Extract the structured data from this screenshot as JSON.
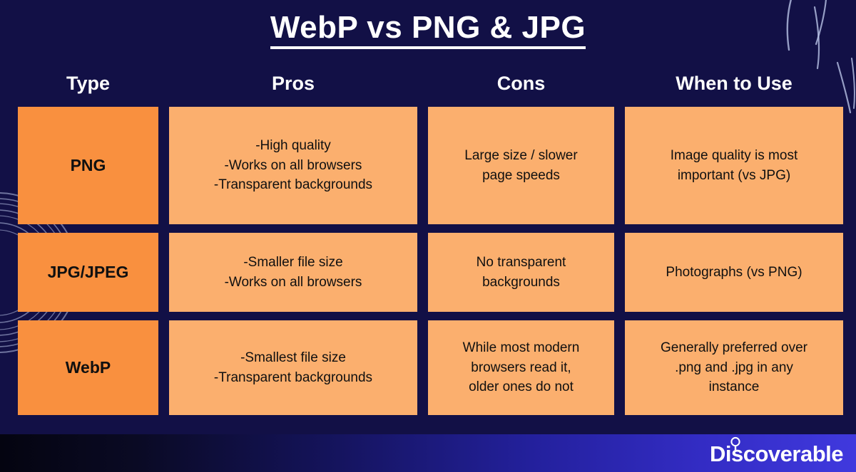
{
  "slide": {
    "title": "WebP vs PNG & JPG",
    "background_color": "#121046",
    "accent_dark_orange": "#F9903F",
    "accent_light_orange": "#FBAF6E"
  },
  "table": {
    "headers": [
      "Type",
      "Pros",
      "Cons",
      "When to Use"
    ],
    "rows": [
      {
        "type": "PNG",
        "pros": [
          "-High quality",
          "-Works on all browsers",
          "-Transparent backgrounds"
        ],
        "cons": [
          "Large size / slower",
          "page speeds"
        ],
        "when_to_use": [
          "Image quality is most",
          "important (vs JPG)"
        ]
      },
      {
        "type": "JPG/JPEG",
        "pros": [
          "-Smaller file size",
          "-Works on all browsers"
        ],
        "cons": [
          "No transparent",
          "backgrounds"
        ],
        "when_to_use": [
          "Photographs (vs PNG)"
        ]
      },
      {
        "type": "WebP",
        "pros": [
          "-Smallest file size",
          "-Transparent backgrounds"
        ],
        "cons": [
          "While most modern",
          "browsers read it,",
          "older ones do not"
        ],
        "when_to_use": [
          "Generally preferred over",
          ".png and .jpg in any",
          "instance"
        ]
      }
    ]
  },
  "footer": {
    "brand": "Discoverable",
    "brand_icon": "magnifier-icon"
  },
  "decorations": {
    "left_arcs": "concentric-arcs",
    "top_right_arcs": "curved-strokes"
  }
}
